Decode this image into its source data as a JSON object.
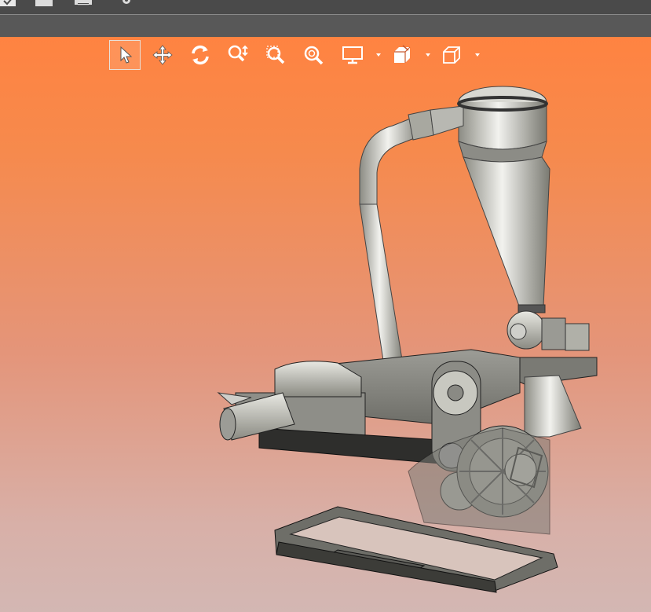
{
  "toolbar": {
    "tools": [
      {
        "name": "select-tool",
        "icon": "cursor-arrow-icon",
        "active": true
      },
      {
        "name": "pan-tool",
        "icon": "move-arrows-icon"
      },
      {
        "name": "rotate-tool",
        "icon": "rotate-icon"
      },
      {
        "name": "zoom-tool",
        "icon": "zoom-vertical-icon"
      },
      {
        "name": "zoom-window-tool",
        "icon": "zoom-window-icon"
      },
      {
        "name": "zoom-fit-tool",
        "icon": "zoom-fit-icon"
      },
      {
        "name": "display-mode-tool",
        "icon": "monitor-icon",
        "has_dropdown": true
      },
      {
        "name": "section-tool",
        "icon": "section-box-icon",
        "has_dropdown": true
      },
      {
        "name": "view-orientation-tool",
        "icon": "cube-icon",
        "has_dropdown": true
      }
    ]
  },
  "quick_access": [
    {
      "name": "open",
      "icon": "open-icon"
    },
    {
      "name": "save",
      "icon": "save-icon"
    },
    {
      "name": "print",
      "icon": "print-icon"
    },
    {
      "name": "settings",
      "icon": "gear-icon"
    }
  ],
  "colors": {
    "topbar": "#4a4a4a",
    "subbar": "#585858",
    "viewport_top": "#ff8341",
    "viewport_bottom": "#d3b7b3",
    "model_metal": "#a8a8a0"
  }
}
